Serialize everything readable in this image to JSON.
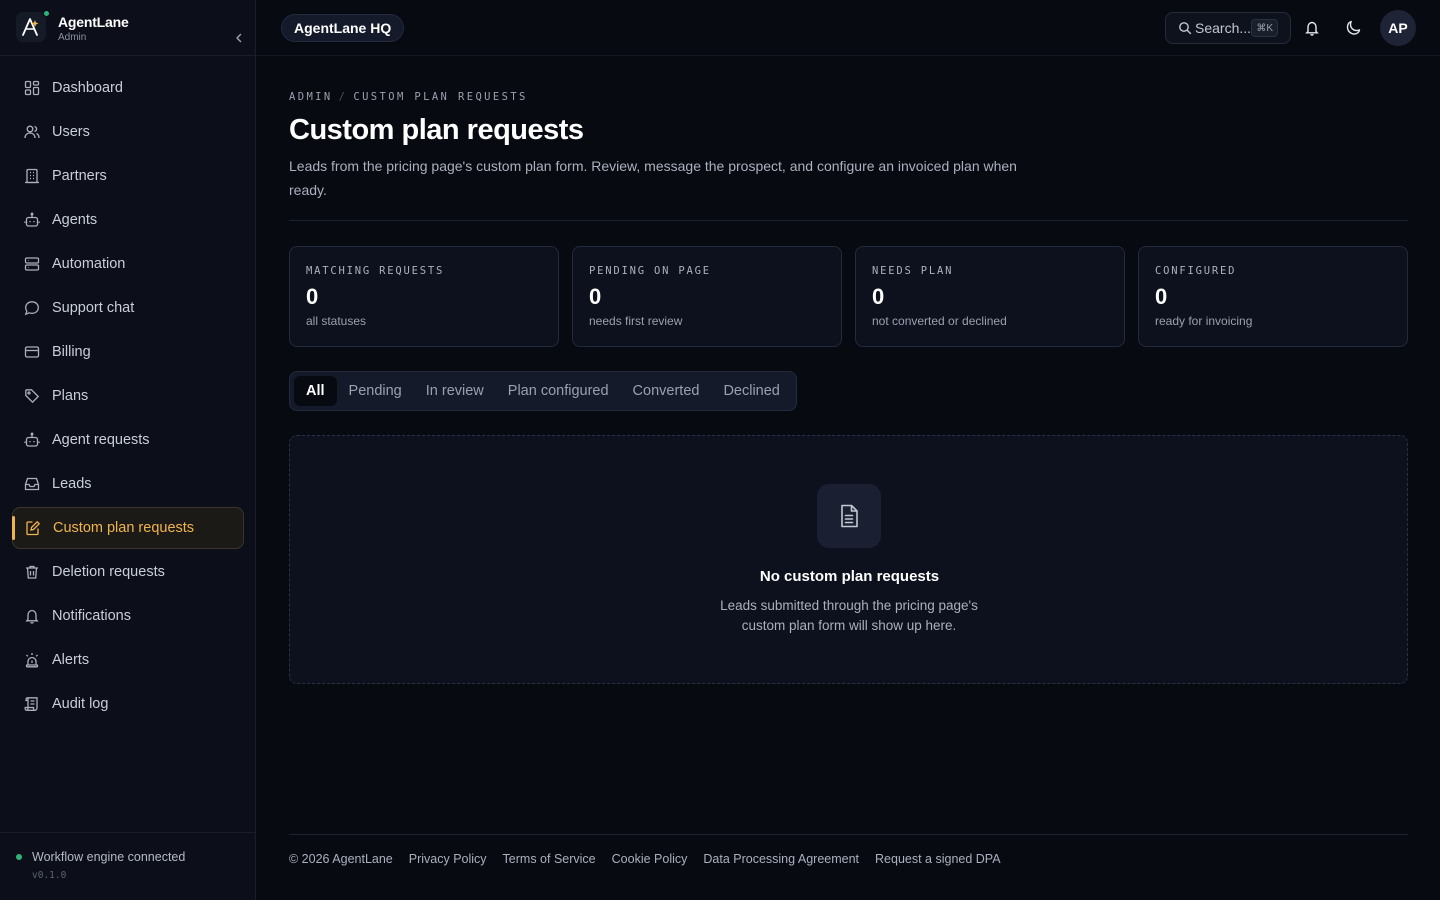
{
  "brand": {
    "name": "AgentLane",
    "role": "Admin"
  },
  "sidebar": {
    "items": [
      {
        "label": "Dashboard",
        "icon": "dashboard-grid-icon"
      },
      {
        "label": "Users",
        "icon": "users-icon"
      },
      {
        "label": "Partners",
        "icon": "building-icon"
      },
      {
        "label": "Agents",
        "icon": "bot-icon"
      },
      {
        "label": "Automation",
        "icon": "server-icon"
      },
      {
        "label": "Support chat",
        "icon": "chat-bubble-icon"
      },
      {
        "label": "Billing",
        "icon": "credit-card-icon"
      },
      {
        "label": "Plans",
        "icon": "tag-icon"
      },
      {
        "label": "Agent requests",
        "icon": "bot-icon"
      },
      {
        "label": "Leads",
        "icon": "inbox-icon"
      },
      {
        "label": "Custom plan requests",
        "icon": "edit-document-icon",
        "active": true
      },
      {
        "label": "Deletion requests",
        "icon": "trash-icon"
      },
      {
        "label": "Notifications",
        "icon": "bell-icon"
      },
      {
        "label": "Alerts",
        "icon": "siren-icon"
      },
      {
        "label": "Audit log",
        "icon": "scroll-icon"
      }
    ],
    "status": "Workflow engine connected",
    "version": "v0.1.0"
  },
  "topbar": {
    "workspace": "AgentLane HQ",
    "search_label": "Search...",
    "search_shortcut": "⌘K",
    "avatar_initials": "AP"
  },
  "page": {
    "breadcrumb": [
      "ADMIN",
      "CUSTOM PLAN REQUESTS"
    ],
    "title": "Custom plan requests",
    "description": "Leads from the pricing page's custom plan form. Review, message the prospect, and configure an invoiced plan when ready."
  },
  "stats": [
    {
      "label": "MATCHING REQUESTS",
      "value": "0",
      "sub": "all statuses"
    },
    {
      "label": "PENDING ON PAGE",
      "value": "0",
      "sub": "needs first review"
    },
    {
      "label": "NEEDS PLAN",
      "value": "0",
      "sub": "not converted or declined"
    },
    {
      "label": "CONFIGURED",
      "value": "0",
      "sub": "ready for invoicing"
    }
  ],
  "tabs": [
    "All",
    "Pending",
    "In review",
    "Plan configured",
    "Converted",
    "Declined"
  ],
  "active_tab": "All",
  "empty_state": {
    "title": "No custom plan requests",
    "description": "Leads submitted through the pricing page's custom plan form will show up here."
  },
  "footer": {
    "copyright": "© 2026 AgentLane",
    "links": [
      "Privacy Policy",
      "Terms of Service",
      "Cookie Policy",
      "Data Processing Agreement",
      "Request a signed DPA"
    ]
  },
  "colors": {
    "background": "#080a12",
    "sidebar": "#0c0f1a",
    "accent": "#f0b44c",
    "status_green": "#2fb37a"
  }
}
